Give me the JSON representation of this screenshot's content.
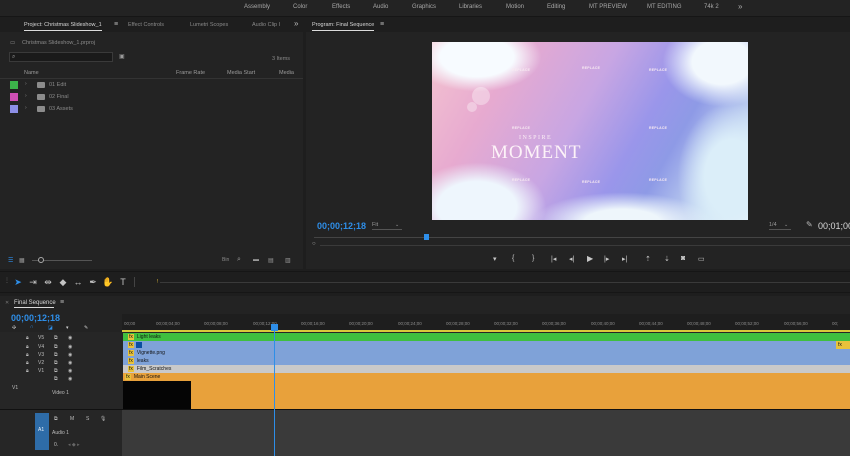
{
  "workspaces": [
    "Assembly",
    "Color",
    "Effects",
    "Audio",
    "Graphics",
    "Libraries",
    "Motion",
    "Editing",
    "MT PREVIEW",
    "MT EDITING",
    "74k 2"
  ],
  "workspace_more": "»",
  "project": {
    "tabs": [
      "Project: Christmas Slideshow_1",
      "Effect Controls",
      "Lumetri Scopes",
      "Audio Clip I"
    ],
    "tab_more": "»",
    "path": "Christmas Slideshow_1.prproj",
    "item_count": "3 Items",
    "columns": [
      "Name",
      "Frame Rate",
      "Media Start",
      "Media"
    ],
    "bins": [
      {
        "name": "01 Edit",
        "color": "#3cb34a"
      },
      {
        "name": "02 Final",
        "color": "#d04fb5"
      },
      {
        "name": "03 Assets",
        "color": "#8d8fe6"
      }
    ]
  },
  "program": {
    "tab": "Program: Final Sequence",
    "menu": "≡",
    "timecode": "00;00;12;18",
    "fit": "Fit",
    "fraction": "1/4",
    "timecode_right": "00;01;00",
    "frame": {
      "subtitle": "INSPIRE",
      "title": "MOMENT",
      "placeholder": "REPLACE"
    }
  },
  "timeline": {
    "tab": "Final Sequence",
    "menu": "≡",
    "timecode": "00;00;12;18",
    "ruler": [
      "00;00",
      "00;00;04;00",
      "00;00;08;00",
      "00;00;12;00",
      "00;00;16;00",
      "00;00;20;00",
      "00;00;24;00",
      "00;00;28;00",
      "00;00;32;00",
      "00;00;36;00",
      "00;00;40;00",
      "00;00;44;00",
      "00;00;48;00",
      "00;00;52;00",
      "00;00;56;00",
      "00;"
    ],
    "tracks": [
      {
        "name": "V5",
        "clip": "Light leaks",
        "color": "#3fbf3f"
      },
      {
        "name": "V4",
        "clip": "",
        "color": "#7fa2d8"
      },
      {
        "name": "V3",
        "clip": "Vignette.png",
        "color": "#7fa2d8"
      },
      {
        "name": "V2",
        "clip": "leaks",
        "color": "#7fa2d8"
      },
      {
        "name": "V1",
        "clip": "Film_Scratches",
        "color": "#c9c9c9"
      },
      {
        "name": "",
        "clip": "Main Scene",
        "color": "#e8a13b"
      }
    ],
    "v1_label": "V1",
    "video1_label": "Video 1",
    "a1_label": "A1",
    "audio1_label": "Audio 1",
    "audio_vol": "0.",
    "m_label": "M",
    "s_label": "S",
    "fx": "fx"
  },
  "colors": {
    "accent_blue": "#2e8ee8",
    "orange": "#e8a13b",
    "green": "#3fbf3f",
    "clip_blue": "#7fa2d8"
  }
}
